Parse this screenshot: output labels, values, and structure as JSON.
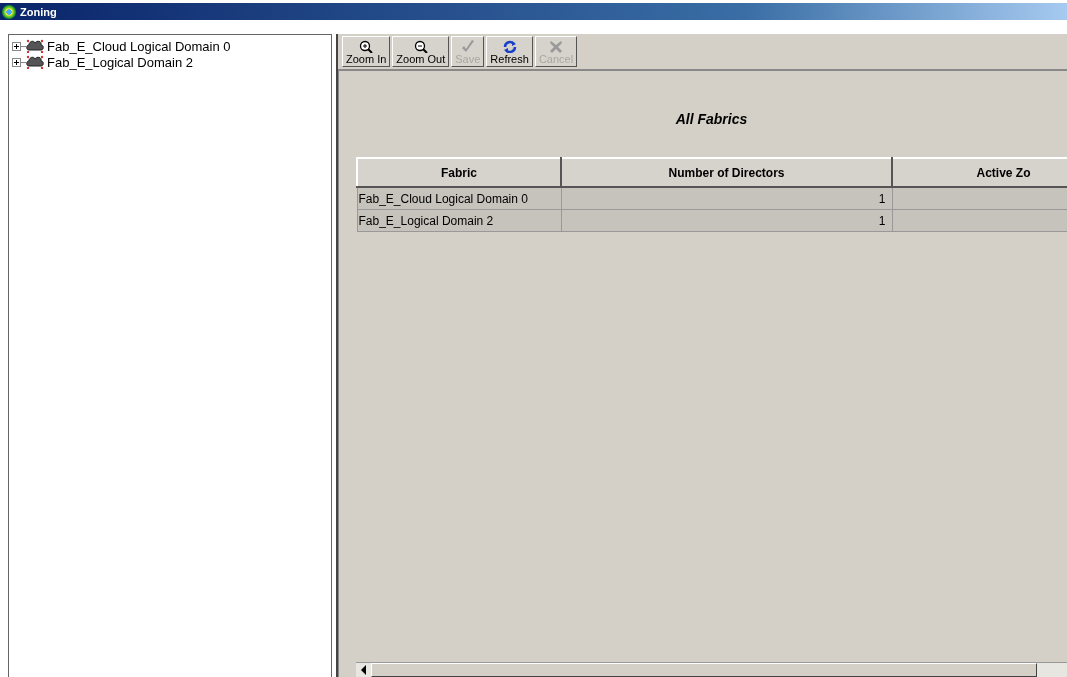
{
  "window": {
    "title": "Zoning"
  },
  "tree": {
    "items": [
      {
        "label": "Fab_E_Cloud Logical Domain 0",
        "expanded": false
      },
      {
        "label": "Fab_E_Logical Domain 2",
        "expanded": false
      }
    ]
  },
  "toolbar": [
    {
      "kind": "zoom-in",
      "label": "Zoom In",
      "disabled": false
    },
    {
      "kind": "zoom-out",
      "label": "Zoom Out",
      "disabled": false
    },
    {
      "kind": "save",
      "label": "Save",
      "disabled": true
    },
    {
      "kind": "refresh",
      "label": "Refresh",
      "disabled": false
    },
    {
      "kind": "cancel",
      "label": "Cancel",
      "disabled": true
    }
  ],
  "heading": "All Fabrics",
  "table": {
    "columns": [
      "Fabric",
      "Number of Directors",
      "Active Zo"
    ],
    "rows": [
      [
        "Fab_E_Cloud Logical Domain 0",
        "1",
        ""
      ],
      [
        "Fab_E_Logical Domain 2",
        "1",
        ""
      ]
    ]
  }
}
